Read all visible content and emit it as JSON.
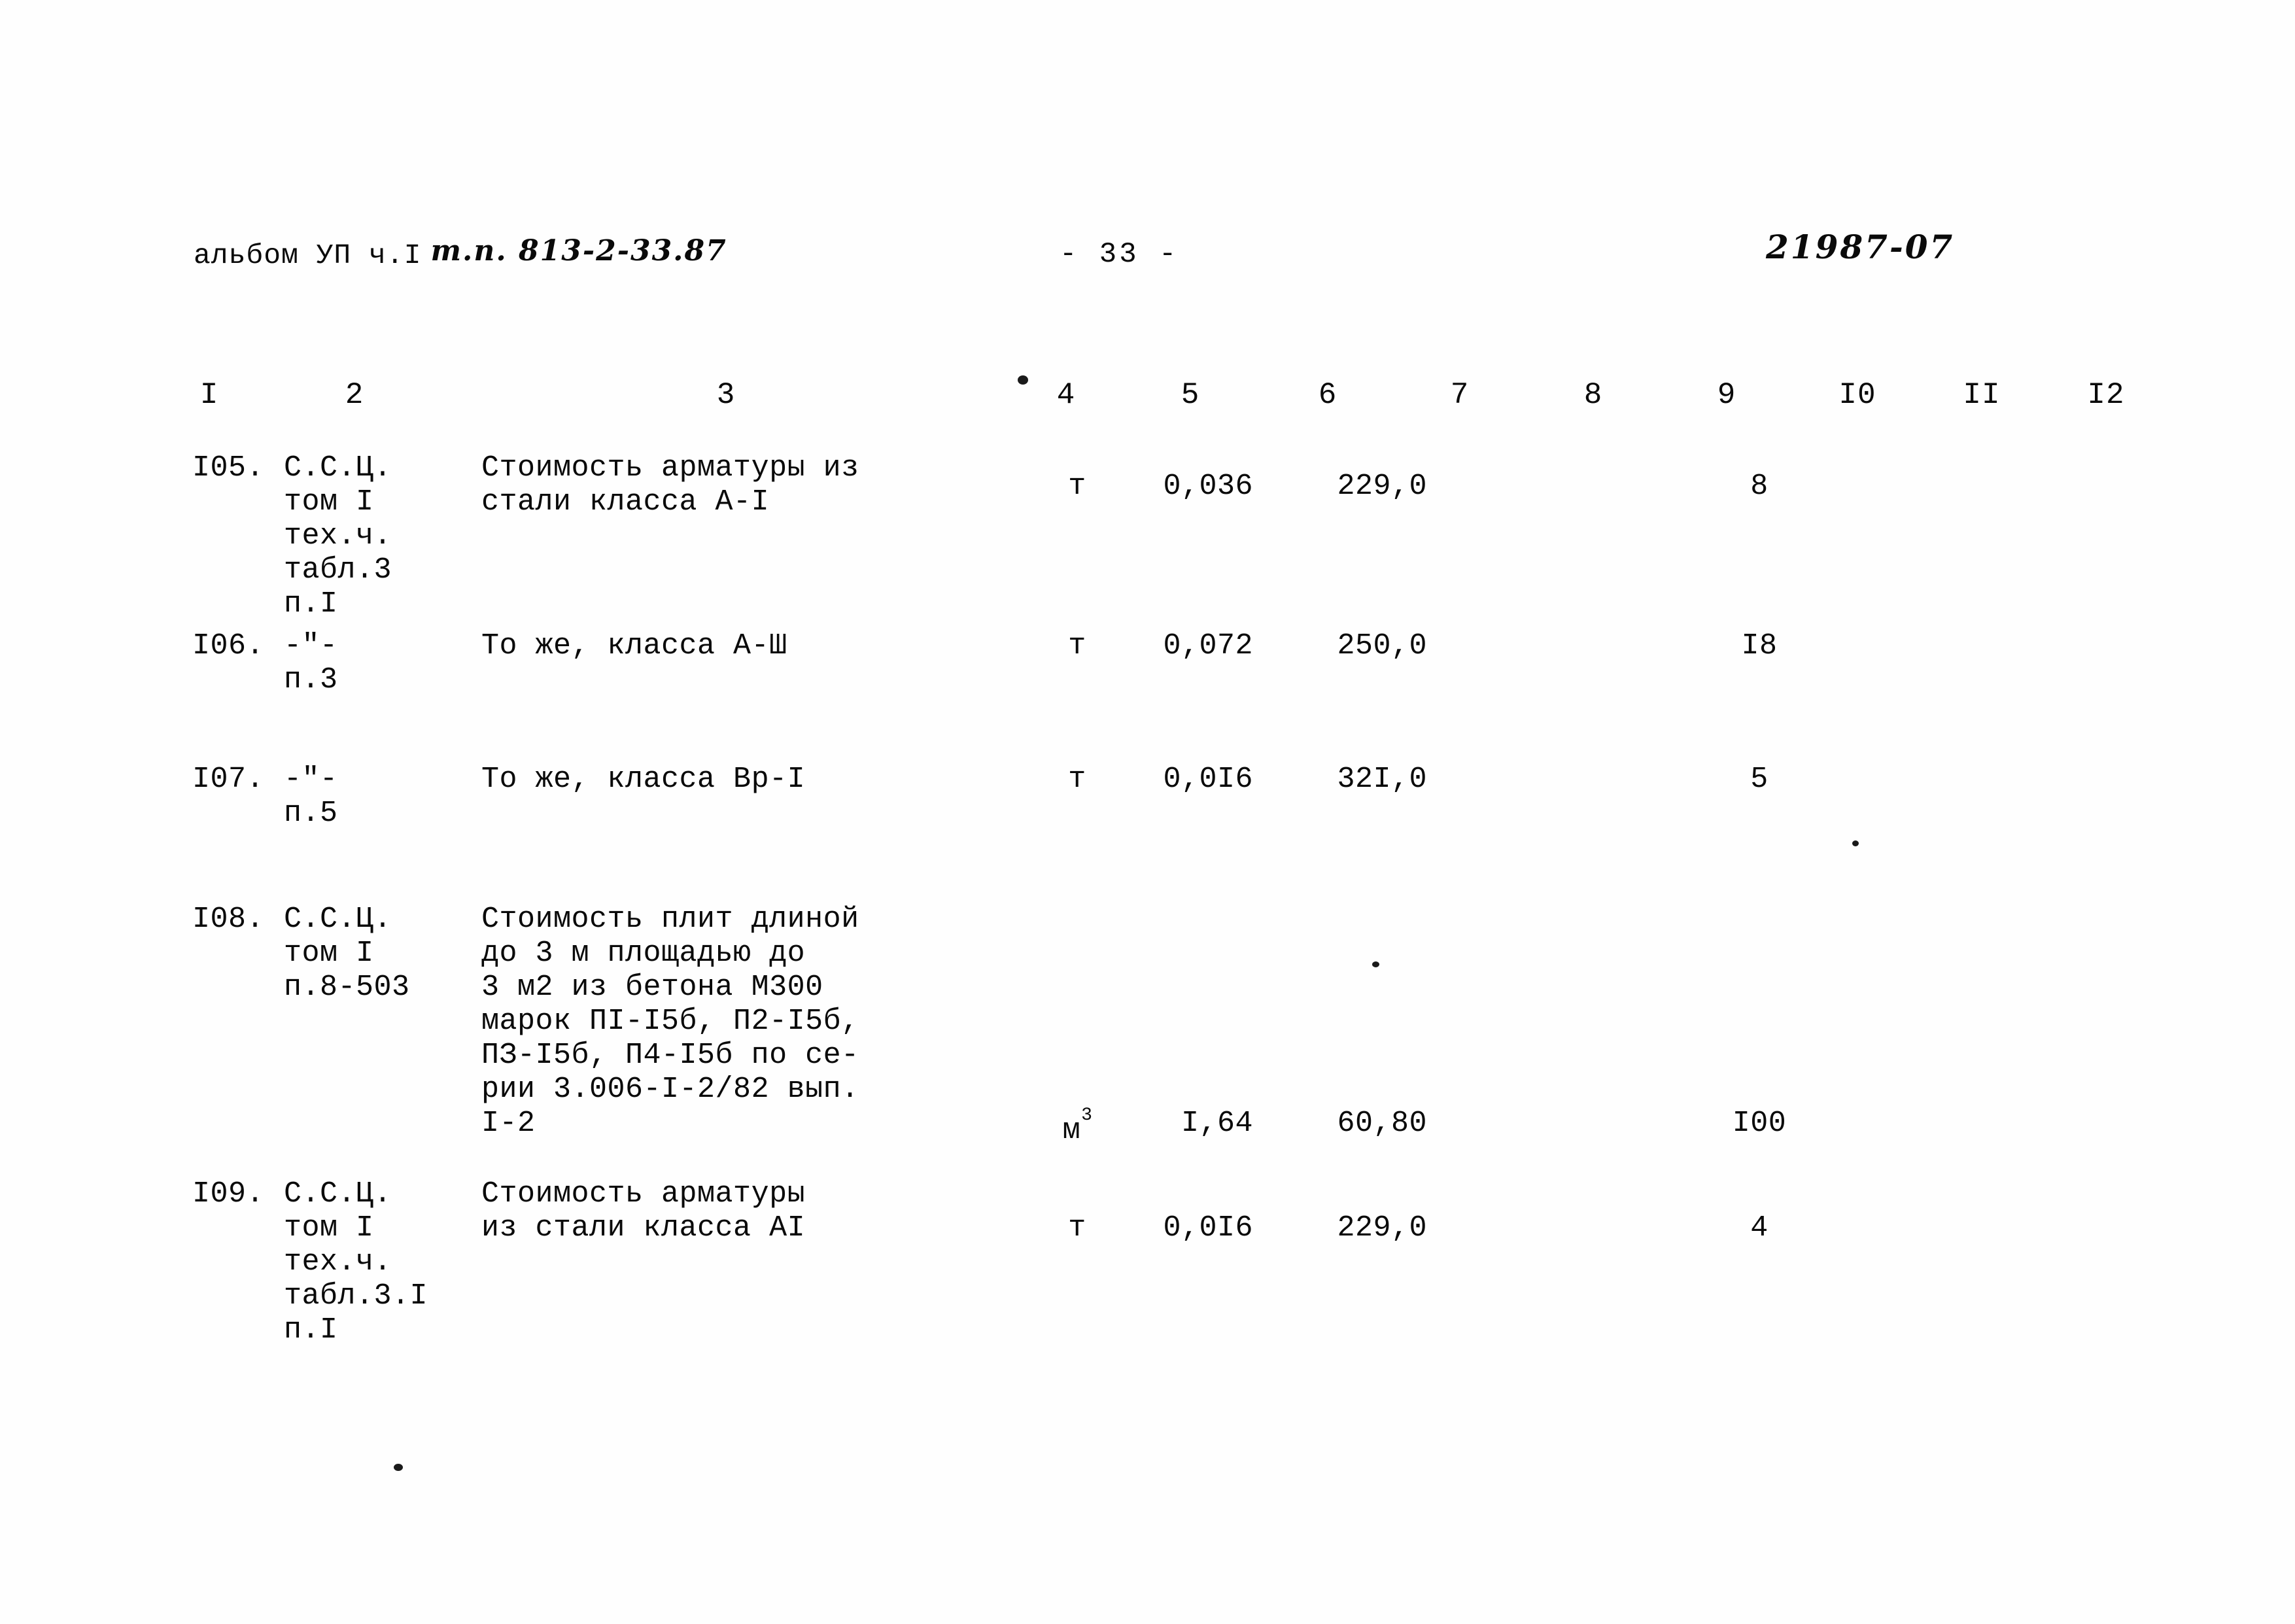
{
  "header": {
    "album": "альбом УП ч.I",
    "project_code": "т.п. 813-2-33.87",
    "page_number": "- 33 -",
    "doc_number": "21987-07"
  },
  "table": {
    "column_headers": [
      "I",
      "2",
      "3",
      "4",
      "5",
      "6",
      "7",
      "8",
      "9",
      "I0",
      "II",
      "I2"
    ],
    "rows": [
      {
        "num": "I05.",
        "reference": "С.С.Ц.\nтом I\nтех.ч.\nтабл.3\nп.I",
        "description": "Стоимость арматуры из\nстали класса А-I",
        "unit": "т",
        "unit_sup": "",
        "quantity": "0,036",
        "price": "229,0",
        "col7": "",
        "col8": "",
        "col9": "8",
        "col10": "",
        "col11": "",
        "col12": ""
      },
      {
        "num": "I06.",
        "reference": "-\"-\nп.3",
        "description": "То же, класса А-Ш",
        "unit": "т",
        "unit_sup": "",
        "quantity": "0,072",
        "price": "250,0",
        "col7": "",
        "col8": "",
        "col9": "I8",
        "col10": "",
        "col11": "",
        "col12": ""
      },
      {
        "num": "I07.",
        "reference": "-\"-\nп.5",
        "description": "То же, класса Вр-I",
        "unit": "т",
        "unit_sup": "",
        "quantity": "0,0I6",
        "price": "32I,0",
        "col7": "",
        "col8": "",
        "col9": "5",
        "col10": "",
        "col11": "",
        "col12": ""
      },
      {
        "num": "I08.",
        "reference": "С.С.Ц.\nтом I\nп.8-503",
        "description": "Стоимость плит длиной\nдо 3 м площадью до\n3 м2 из бетона М300\nмарок ПI-I5б, П2-I5б,\nПЗ-I5б, П4-I5б по се-\nрии 3.006-I-2/82 вып.\nI-2",
        "unit": "м",
        "unit_sup": "3",
        "quantity": "I,64",
        "price": "60,80",
        "col7": "",
        "col8": "",
        "col9": "I00",
        "col10": "",
        "col11": "",
        "col12": ""
      },
      {
        "num": "I09.",
        "reference": "С.С.Ц.\nтом I\nтех.ч.\nтабл.3.I\nп.I",
        "description": "Стоимость арматуры\nиз стали класса АI",
        "unit": "т",
        "unit_sup": "",
        "quantity": "0,0I6",
        "price": "229,0",
        "col7": "",
        "col8": "",
        "col9": "4",
        "col10": "",
        "col11": "",
        "col12": ""
      }
    ]
  }
}
